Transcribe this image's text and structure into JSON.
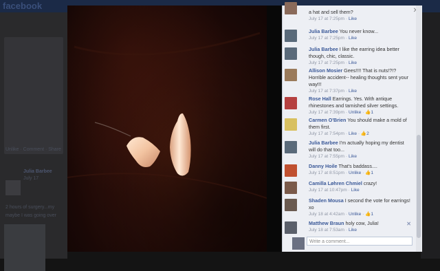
{
  "background": {
    "logo": "facebook",
    "post_actions": "Unlike · Comment · Share",
    "post_author": "Julia Barbee",
    "post_time": "July 17",
    "post_text_1": "2 hours of surgery...my",
    "post_text_2": "maybe I was going over"
  },
  "photo": {
    "alt": "Two extracted teeth on a dark wooden surface"
  },
  "panel": {
    "close_icon": "close-icon",
    "comments": [
      {
        "name": "",
        "text": "a hat and sell them?",
        "time": "July 17 at 7:25pm",
        "action": "Like",
        "likes": "",
        "avatar_color": "#8a6a5a"
      },
      {
        "name": "Julia Barbee",
        "text": "You never know...",
        "time": "July 17 at 7:25pm",
        "action": "Like",
        "likes": "",
        "avatar_color": "#5a6a7a"
      },
      {
        "name": "Julia Barbee",
        "text": "I like the earring idea better though, chic, classic.",
        "time": "July 17 at 7:25pm",
        "action": "Like",
        "likes": "",
        "avatar_color": "#5a6a7a"
      },
      {
        "name": "Allison Mosier",
        "text": "Gees!!!! That is nuts!?!? Horrible accident-- healing thoughts sent your way!!!",
        "time": "July 17 at 7:37pm",
        "action": "Like",
        "likes": "",
        "avatar_color": "#9a7a5a"
      },
      {
        "name": "Rose Hall",
        "text": "Earrings. Yes. With antique rhinestones and tarnished silver settings.",
        "time": "July 17 at 7:39pm",
        "action": "Unlike",
        "likes": "1",
        "avatar_color": "#b54040"
      },
      {
        "name": "Carmen O'Brien",
        "text": "You should make a mold of them first.",
        "time": "July 17 at 7:54pm",
        "action": "Like",
        "likes": "2",
        "avatar_color": "#d8c060"
      },
      {
        "name": "Julia Barbee",
        "text": "I'm actually hoping my dentist will do that too...",
        "time": "July 17 at 7:55pm",
        "action": "Like",
        "likes": "",
        "avatar_color": "#5a6a7a"
      },
      {
        "name": "Danny Hoile",
        "text": "That's baddass....",
        "time": "July 17 at 8:51pm",
        "action": "Unlike",
        "likes": "1",
        "avatar_color": "#c05030"
      },
      {
        "name": "Camilla Løhren Chmiel",
        "text": "crazy!",
        "time": "July 17 at 10:47pm",
        "action": "Like",
        "likes": "",
        "avatar_color": "#7a5a4a"
      },
      {
        "name": "Shaden Mousa",
        "text": "I second the vote for earrings! xo",
        "time": "July 18 at 4:42am",
        "action": "Unlike",
        "likes": "1",
        "avatar_color": "#6a5a50"
      },
      {
        "name": "Matthew Braun",
        "text": "holy cow, Julia!",
        "time": "July 18 at 7:53am",
        "action": "Like",
        "likes": "",
        "avatar_color": "#5a5f6a"
      }
    ],
    "write_placeholder": "Write a comment..."
  }
}
